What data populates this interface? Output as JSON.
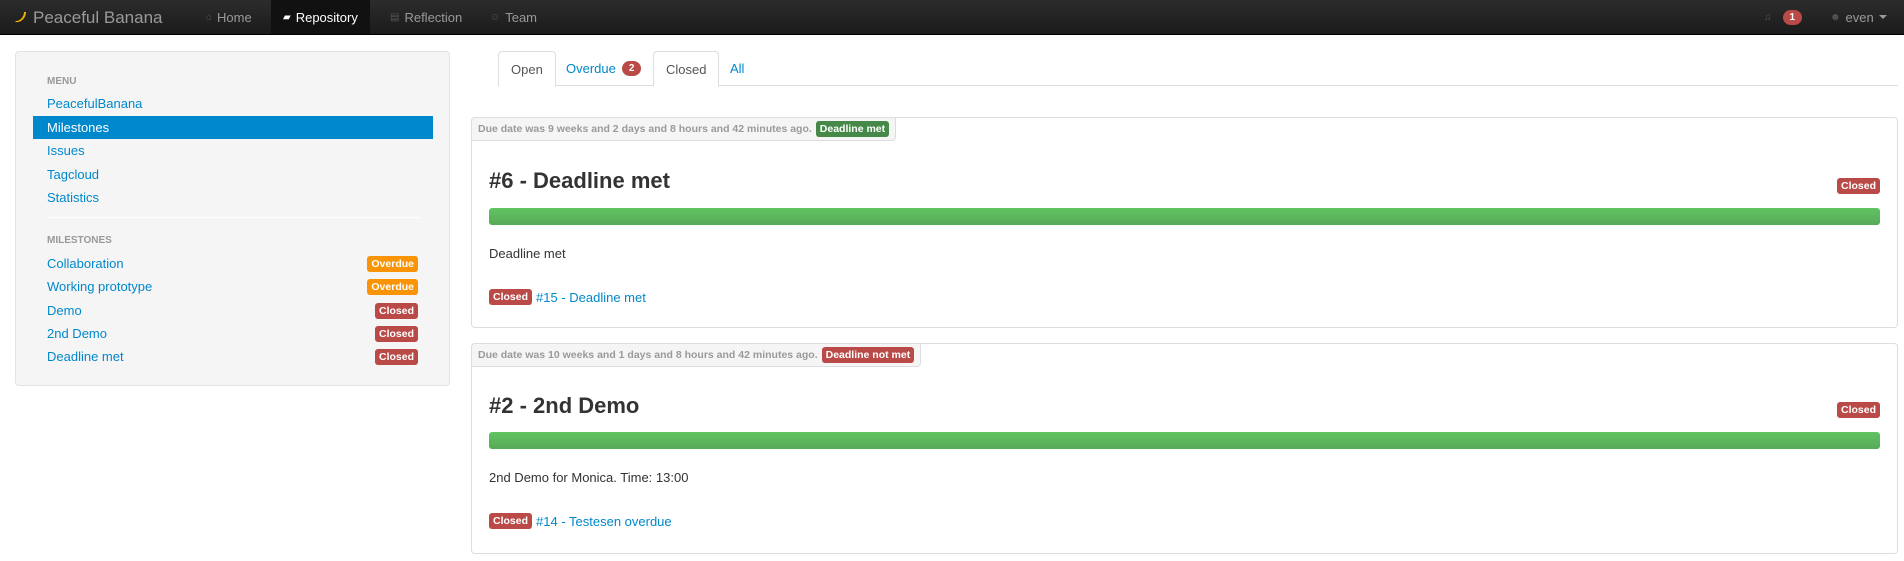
{
  "navbar": {
    "brand": "Peaceful Banana",
    "brand_icon": "banana-icon",
    "items": [
      {
        "label": "Home",
        "icon": "home-icon"
      },
      {
        "label": "Repository",
        "icon": "folder-open-icon"
      },
      {
        "label": "Reflection",
        "icon": "book-icon"
      },
      {
        "label": "Team",
        "icon": "team-icon"
      }
    ],
    "notifications_count": "1",
    "user": "even"
  },
  "sidebar": {
    "menu_header": "MENU",
    "menu": [
      {
        "label": "PeacefulBanana",
        "active": false
      },
      {
        "label": "Milestones",
        "active": true
      },
      {
        "label": "Issues",
        "active": false
      },
      {
        "label": "Tagcloud",
        "active": false
      },
      {
        "label": "Statistics",
        "active": false
      }
    ],
    "milestones_header": "MILESTONES",
    "milestones": [
      {
        "label": "Collaboration",
        "status": "Overdue"
      },
      {
        "label": "Working prototype",
        "status": "Overdue"
      },
      {
        "label": "Demo",
        "status": "Closed"
      },
      {
        "label": "2nd Demo",
        "status": "Closed"
      },
      {
        "label": "Deadline met",
        "status": "Closed"
      }
    ]
  },
  "tabs": [
    {
      "label": "Open"
    },
    {
      "label": "Overdue",
      "badge": "2"
    },
    {
      "label": "Closed"
    },
    {
      "label": "All"
    }
  ],
  "cards": [
    {
      "due": "Due date was 9 weeks and 2 days and 8 hours and 42 minutes ago.",
      "due_label": "Deadline met",
      "title": "#6 - Deadline met",
      "status": "Closed",
      "progress": 1.0,
      "description": "Deadline met",
      "issue_status": "Closed",
      "issue": "#15 - Deadline met"
    },
    {
      "due": "Due date was 10 weeks and 1 days and 8 hours and 42 minutes ago.",
      "due_label": "Deadline not met",
      "title": "#2 - 2nd Demo",
      "status": "Closed",
      "progress": 1.0,
      "description": "2nd Demo for Monica. Time: 13:00",
      "issue_status": "Closed",
      "issue": "#14 - Testesen overdue"
    }
  ],
  "colors": {
    "accent": "#0088cc",
    "important": "#b94a48",
    "warning": "#f89406",
    "success": "#468847",
    "progress": "#62c462"
  }
}
